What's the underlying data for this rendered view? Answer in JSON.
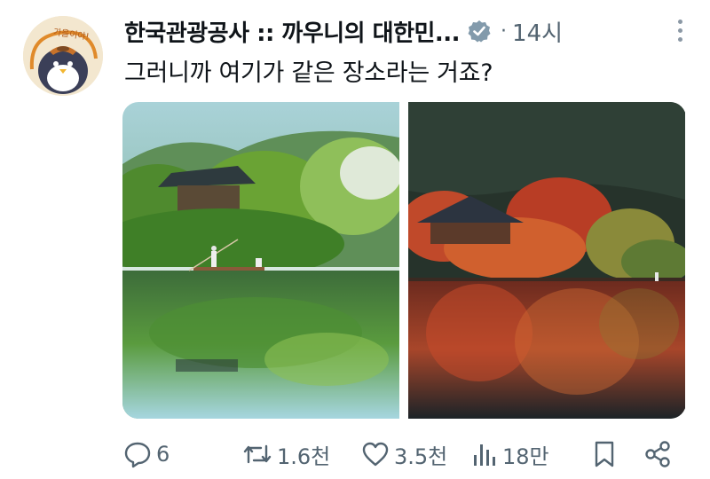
{
  "tweet": {
    "display_name": "한국관광공사 :: 까우니의 대한민...",
    "verified": true,
    "timestamp": "14시",
    "text": "그러니까 여기가 같은 장소라는 거죠?",
    "avatar_text": "가을이야!",
    "icons": {
      "verified": "verified-badge-icon",
      "more": "more-options-icon"
    }
  },
  "media": {
    "images": [
      {
        "description_icon": "summer-lake-pavilion-image"
      },
      {
        "description_icon": "autumn-lake-pavilion-image"
      }
    ]
  },
  "actions": {
    "reply_count": "6",
    "retweet_count": "1.6천",
    "like_count": "3.5천",
    "view_count": "18만"
  },
  "colors": {
    "text": "#0f1419",
    "muted": "#536471",
    "verified": "#829aab"
  }
}
